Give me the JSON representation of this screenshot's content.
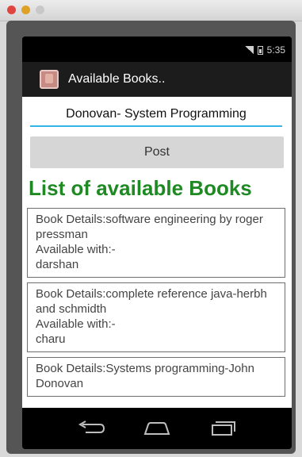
{
  "status_bar": {
    "time": "5:35"
  },
  "action_bar": {
    "title": "Available Books.."
  },
  "form": {
    "input_value": "Donovan- System Programming",
    "post_label": "Post"
  },
  "list": {
    "heading": "List of available Books",
    "books": [
      {
        "details": "Book Details:software engineering by roger pressman",
        "available_label": "Available with:-",
        "owner": "darshan"
      },
      {
        "details": "Book Details:complete reference java-herbh and schmidth",
        "available_label": "Available with:-",
        "owner": "charu"
      },
      {
        "details": "Book Details:Systems programming-John Donovan"
      }
    ]
  },
  "colors": {
    "heading": "#1f8a23",
    "input_underline": "#33b5e5",
    "action_bar": "#1c1c1c"
  },
  "icons": [
    "signal-icon",
    "battery-icon",
    "app-icon",
    "back-icon",
    "home-icon",
    "recents-icon"
  ]
}
